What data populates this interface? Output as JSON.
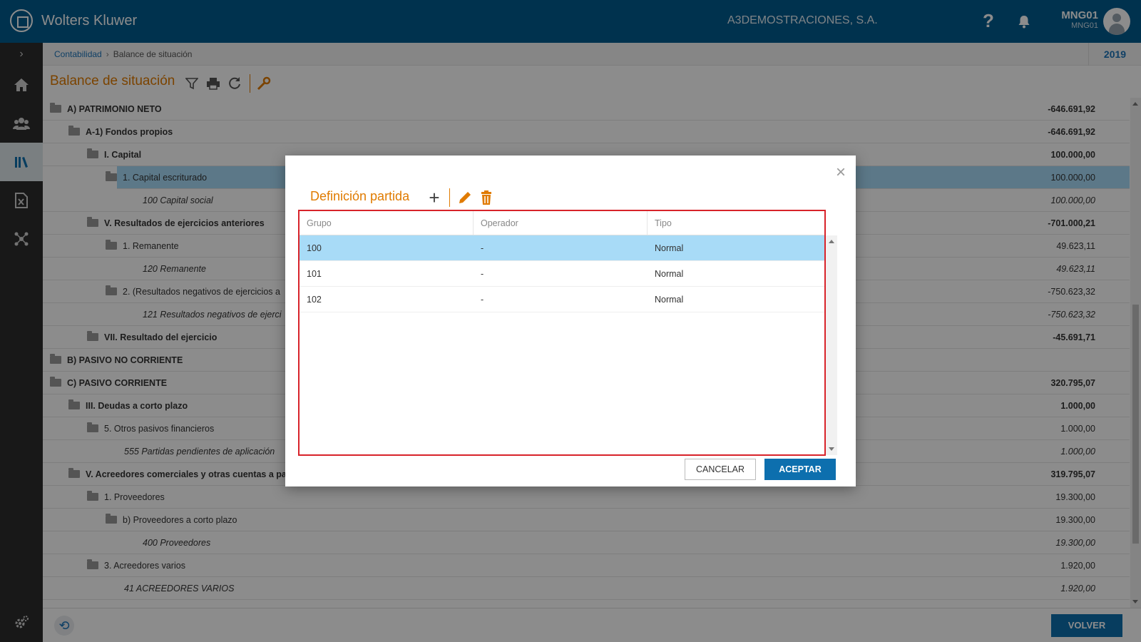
{
  "app": {
    "brand": "Wolters Kluwer",
    "company": "A3DEMOSTRACIONES, S.A.",
    "help_glyph": "?"
  },
  "user": {
    "name": "MNG01",
    "code": "MNG01"
  },
  "breadcrumb": {
    "root": "Contabilidad",
    "current": "Balance de situación",
    "year": "2019"
  },
  "page": {
    "title": "Balance de situación"
  },
  "tree_rows": [
    {
      "label": "A) PATRIMONIO NETO",
      "value": "-646.691,92",
      "level": 0,
      "folder": true,
      "bold": true
    },
    {
      "label": "A-1) Fondos propios",
      "value": "-646.691,92",
      "level": 1,
      "folder": true,
      "bold": true
    },
    {
      "label": "I. Capital",
      "value": "100.000,00",
      "level": 2,
      "folder": true,
      "bold": true
    },
    {
      "label": "1. Capital escriturado",
      "value": "100.000,00",
      "level": 3,
      "folder": true,
      "selected": true
    },
    {
      "label": "100 Capital social",
      "value": "100.000,00",
      "level": 4,
      "italic": true
    },
    {
      "label": "V. Resultados de ejercicios anteriores",
      "value": "-701.000,21",
      "level": 2,
      "folder": true,
      "bold": true
    },
    {
      "label": "1. Remanente",
      "value": "49.623,11",
      "level": 3,
      "folder": true
    },
    {
      "label": "120 Remanente",
      "value": "49.623,11",
      "level": 4,
      "italic": true
    },
    {
      "label": "2. (Resultados negativos de ejercicios a",
      "value": "-750.623,32",
      "level": 3,
      "folder": true
    },
    {
      "label": "121 Resultados negativos de ejerci",
      "value": "-750.623,32",
      "level": 4,
      "italic": true
    },
    {
      "label": "VII. Resultado del ejercicio",
      "value": "-45.691,71",
      "level": 2,
      "folder": true,
      "bold": true
    },
    {
      "label": "B) PASIVO NO CORRIENTE",
      "value": "",
      "level": 0,
      "folder": true,
      "bold": true
    },
    {
      "label": "C) PASIVO CORRIENTE",
      "value": "320.795,07",
      "level": 0,
      "folder": true,
      "bold": true
    },
    {
      "label": "III. Deudas a corto plazo",
      "value": "1.000,00",
      "level": 1,
      "folder": true,
      "bold": true
    },
    {
      "label": "5. Otros pasivos financieros",
      "value": "1.000,00",
      "level": 2,
      "folder": true
    },
    {
      "label": "555 Partidas pendientes de aplicación",
      "value": "1.000,00",
      "level": 3,
      "italic": true
    },
    {
      "label": "V. Acreedores comerciales y otras cuentas a pag",
      "value": "319.795,07",
      "level": 1,
      "folder": true,
      "bold": true
    },
    {
      "label": "1. Proveedores",
      "value": "19.300,00",
      "level": 2,
      "folder": true
    },
    {
      "label": "b) Proveedores a corto plazo",
      "value": "19.300,00",
      "level": 3,
      "folder": true
    },
    {
      "label": "400 Proveedores",
      "value": "19.300,00",
      "level": 4,
      "italic": true
    },
    {
      "label": "3. Acreedores varios",
      "value": "1.920,00",
      "level": 2,
      "folder": true
    },
    {
      "label": "41 ACREEDORES VARIOS",
      "value": "1.920,00",
      "level": 3,
      "italic": true
    }
  ],
  "footer": {
    "volver_label": "VOLVER"
  },
  "modal": {
    "title": "Definición partida",
    "columns": [
      "Grupo",
      "Operador",
      "Tipo"
    ],
    "rows": [
      {
        "grupo": "100",
        "operador": "-",
        "tipo": "Normal",
        "selected": true
      },
      {
        "grupo": "101",
        "operador": "-",
        "tipo": "Normal"
      },
      {
        "grupo": "102",
        "operador": "-",
        "tipo": "Normal"
      }
    ],
    "cancel_label": "CANCELAR",
    "accept_label": "ACEPTAR"
  },
  "colors": {
    "header": "#005b8e",
    "accent": "#e07b00",
    "primary_button": "#0d6fae",
    "selection": "#a8dbf7",
    "highlight_border": "#d8232a"
  }
}
